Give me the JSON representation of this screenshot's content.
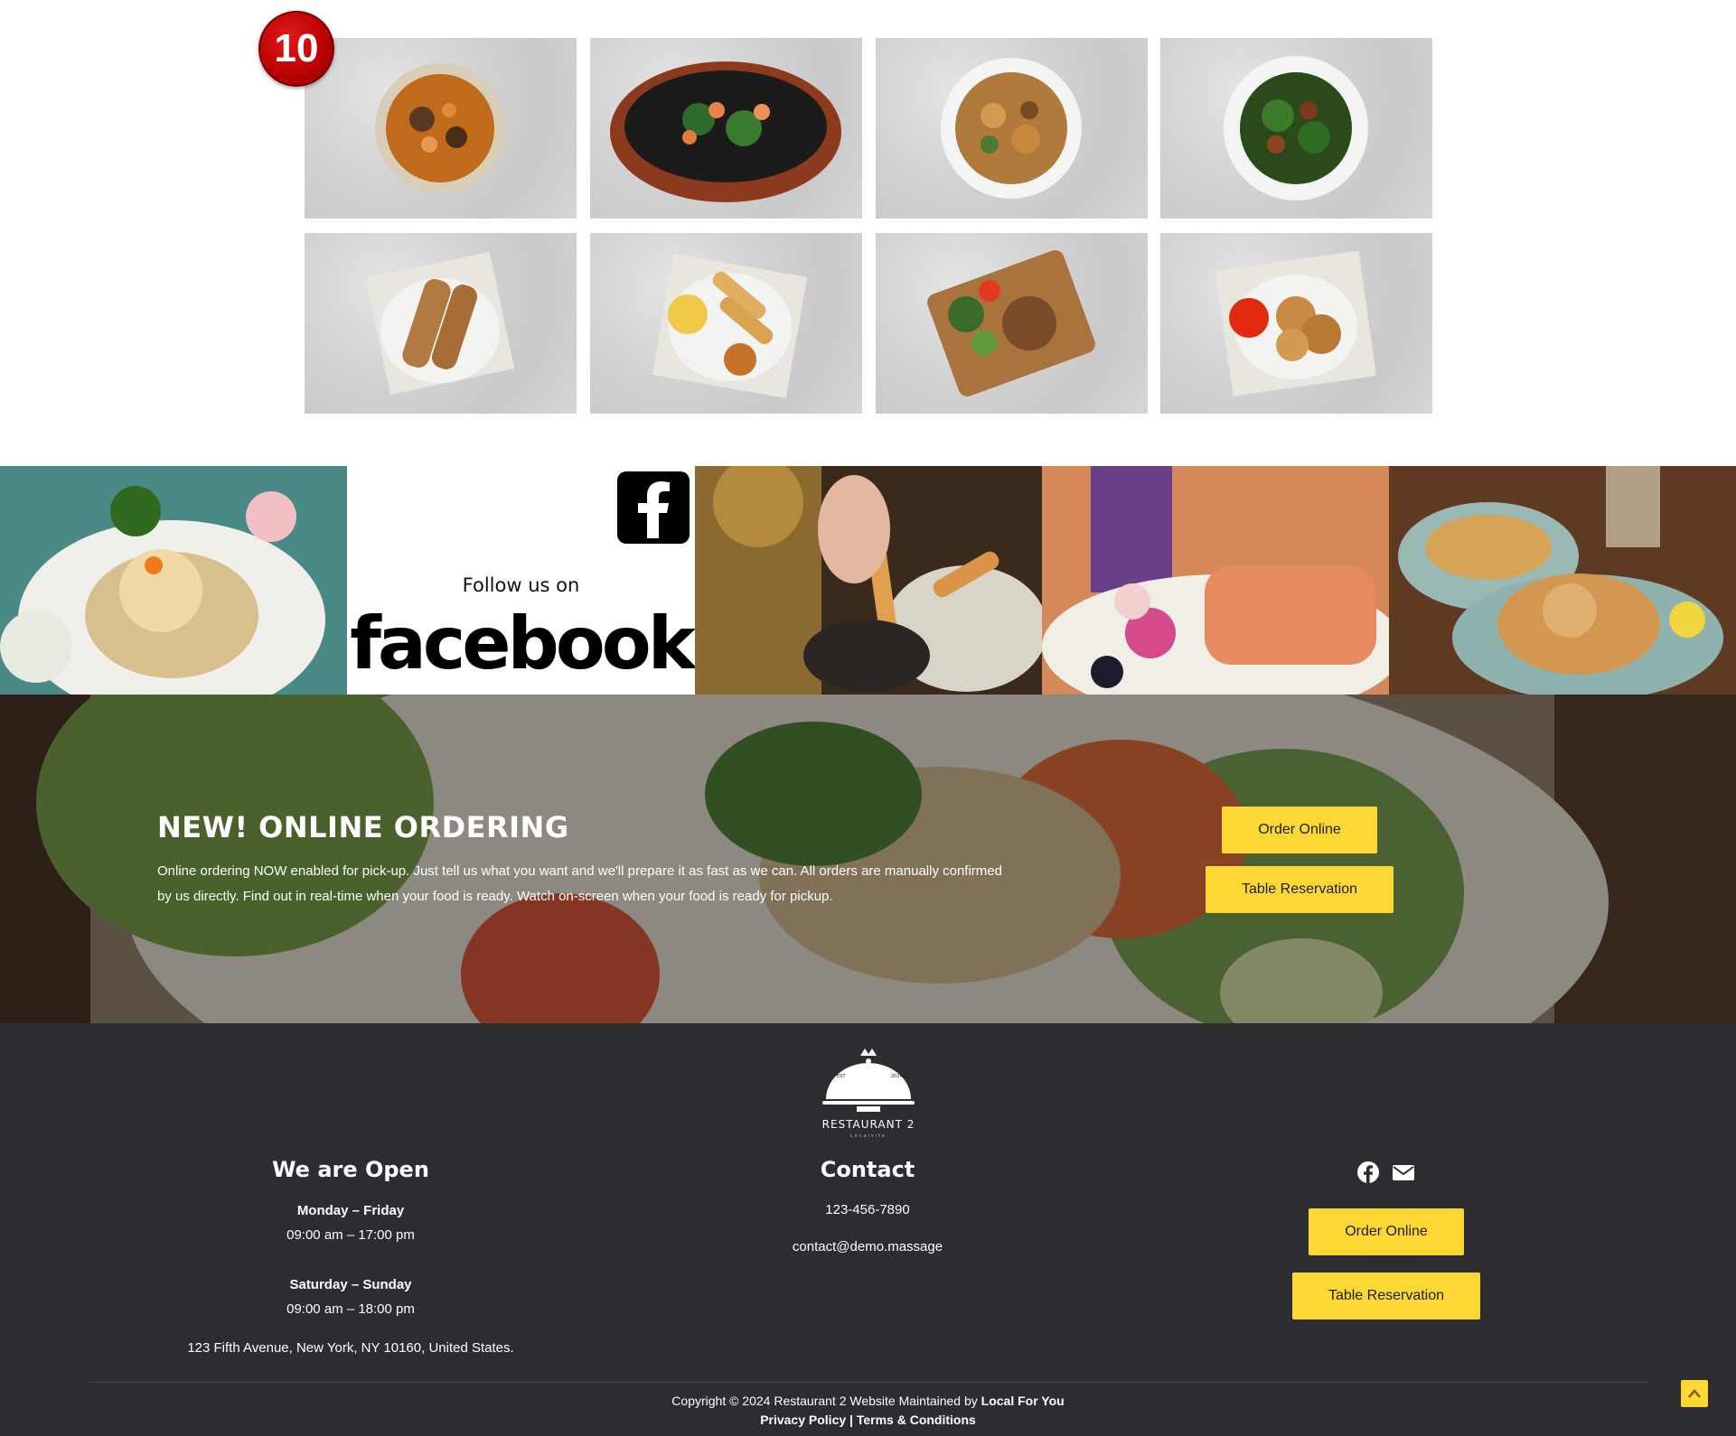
{
  "gallery": {
    "badge": "10",
    "items": [
      "dish-curry-bowl",
      "dish-sizzling-seafood",
      "dish-crispy-pork-salad",
      "dish-stirfry-greens",
      "dish-satay-skewers",
      "dish-spring-rolls-platter",
      "dish-grilled-meat-board",
      "dish-fried-chicken"
    ]
  },
  "social_strip": {
    "follow_text": "Follow us on",
    "brand_word": "facebook"
  },
  "online_ordering": {
    "title": "NEW! ONLINE ORDERING",
    "text": "Online ordering NOW enabled for pick-up. Just tell us what you want and we'll prepare it as fast as we can. All orders are manually confirmed by us directly. Find out in real-time when your food is ready. Watch on-screen when your food is ready for pickup.",
    "order_button": "Order Online",
    "reservation_button": "Table Reservation"
  },
  "footer": {
    "logo_name": "RESTAURANT 2",
    "logo_tagline": "Localsite",
    "logo_est_left": "EST",
    "logo_est_right": "2024",
    "hours": {
      "title": "We are Open",
      "weekday_label": "Monday – Friday",
      "weekday_hours": "09:00 am – 17:00 pm",
      "weekend_label": "Saturday – Sunday",
      "weekend_hours": "09:00 am – 18:00 pm",
      "address": "123 Fifth Avenue, New York, NY 10160, United States."
    },
    "contact": {
      "title": "Contact",
      "phone": "123-456-7890",
      "email": "contact@demo.massage"
    },
    "actions": {
      "icons": [
        "facebook-icon",
        "envelope-icon"
      ],
      "order_button": "Order Online",
      "reservation_button": "Table Reservation"
    },
    "copyright_prefix": "Copyright © 2024 Restaurant 2 Website Maintained by ",
    "copyright_link": "Local For You",
    "privacy": "Privacy Policy",
    "separator": "|",
    "terms": "Terms & Conditions"
  },
  "colors": {
    "accent_yellow": "#fdd835",
    "footer_bg": "#2d2c30",
    "badge_red": "#b80000"
  }
}
